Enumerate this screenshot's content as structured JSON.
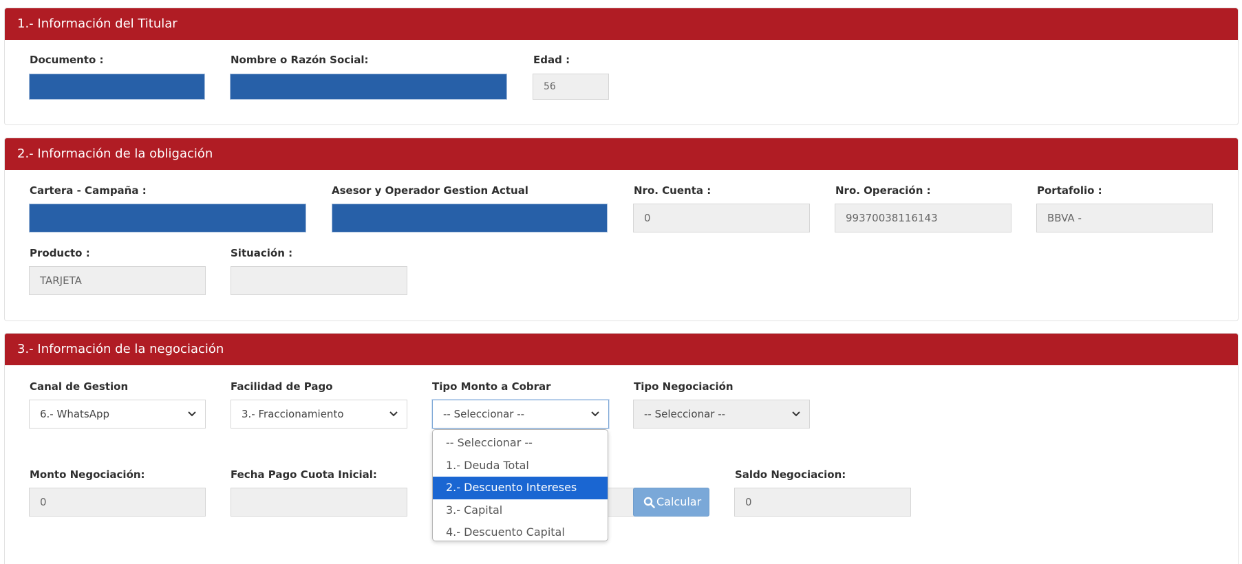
{
  "section1": {
    "title": "1.- Información del Titular",
    "documento_label": "Documento :",
    "documento_value": "",
    "nombre_label": "Nombre o Razón Social:",
    "nombre_value": "",
    "edad_label": "Edad :",
    "edad_value": "56"
  },
  "section2": {
    "title": "2.- Información de la obligación",
    "cartera_label": "Cartera - Campaña :",
    "cartera_value": "",
    "asesor_label": "Asesor y Operador Gestion Actual",
    "asesor_value": "",
    "nro_cuenta_label": "Nro. Cuenta :",
    "nro_cuenta_value": "0",
    "nro_operacion_label": "Nro. Operación :",
    "nro_operacion_value": "99370038116143",
    "portafolio_label": "Portafolio :",
    "portafolio_value": "BBVA -",
    "producto_label": "Producto :",
    "producto_value": "TARJETA",
    "situacion_label": "Situación :",
    "situacion_value": ""
  },
  "section3": {
    "title": "3.- Información de la negociación",
    "canal_label": "Canal de Gestion",
    "canal_value": "6.- WhatsApp",
    "facilidad_label": "Facilidad de Pago",
    "facilidad_value": "3.- Fraccionamiento",
    "tipo_monto_label": "Tipo Monto a Cobrar",
    "tipo_monto_value": "-- Seleccionar --",
    "tipo_negociacion_label": "Tipo Negociación",
    "tipo_negociacion_value": "-- Seleccionar --",
    "monto_label": "Monto Negociación:",
    "monto_value": "0",
    "fecha_label": "Fecha Pago Cuota Inicial:",
    "fecha_value": "",
    "calcular_label": "Calcular",
    "saldo_label": "Saldo Negociacion:",
    "saldo_value": "0"
  },
  "dropdown": {
    "options": [
      "-- Seleccionar --",
      "1.- Deuda Total",
      "2.- Descuento Intereses",
      "3.- Capital",
      "4.- Descuento Capital"
    ],
    "highlighted_index": 2
  },
  "colors": {
    "header_red": "#b01c24",
    "masked_blue": "#2760a8",
    "highlight_blue": "#1a66d2",
    "button_blue": "#7aa8d8"
  },
  "icons": {
    "select": "chevron-down-icon",
    "calcular": "search-icon"
  }
}
